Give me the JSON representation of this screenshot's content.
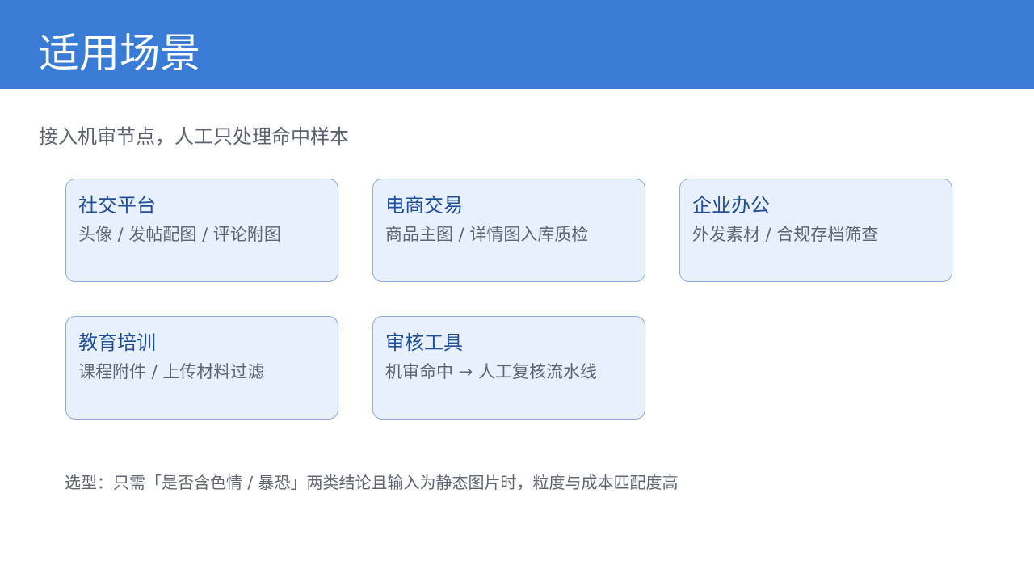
{
  "header": {
    "title": "适用场景",
    "background_color": "#3a7bd5"
  },
  "subtitle": "接入机审节点，人工只处理命中样本",
  "cards": [
    {
      "title": "社交平台",
      "desc": "头像 / 发帖配图 / 评论附图"
    },
    {
      "title": "电商交易",
      "desc": "商品主图 / 详情图入库质检"
    },
    {
      "title": "企业办公",
      "desc": "外发素材 / 合规存档筛查"
    },
    {
      "title": "教育培训",
      "desc": "课程附件 / 上传材料过滤"
    },
    {
      "title": "审核工具",
      "desc": "机审命中 → 人工复核流水线"
    }
  ],
  "footnote": "选型：只需「是否含色情 / 暴恐」两类结论且输入为静态图片时，粒度与成本匹配度高",
  "colors": {
    "card_background": "#e8f0fd",
    "card_border": "#8eacd8",
    "card_title": "#1f4f99",
    "body_text": "#5f6672"
  }
}
